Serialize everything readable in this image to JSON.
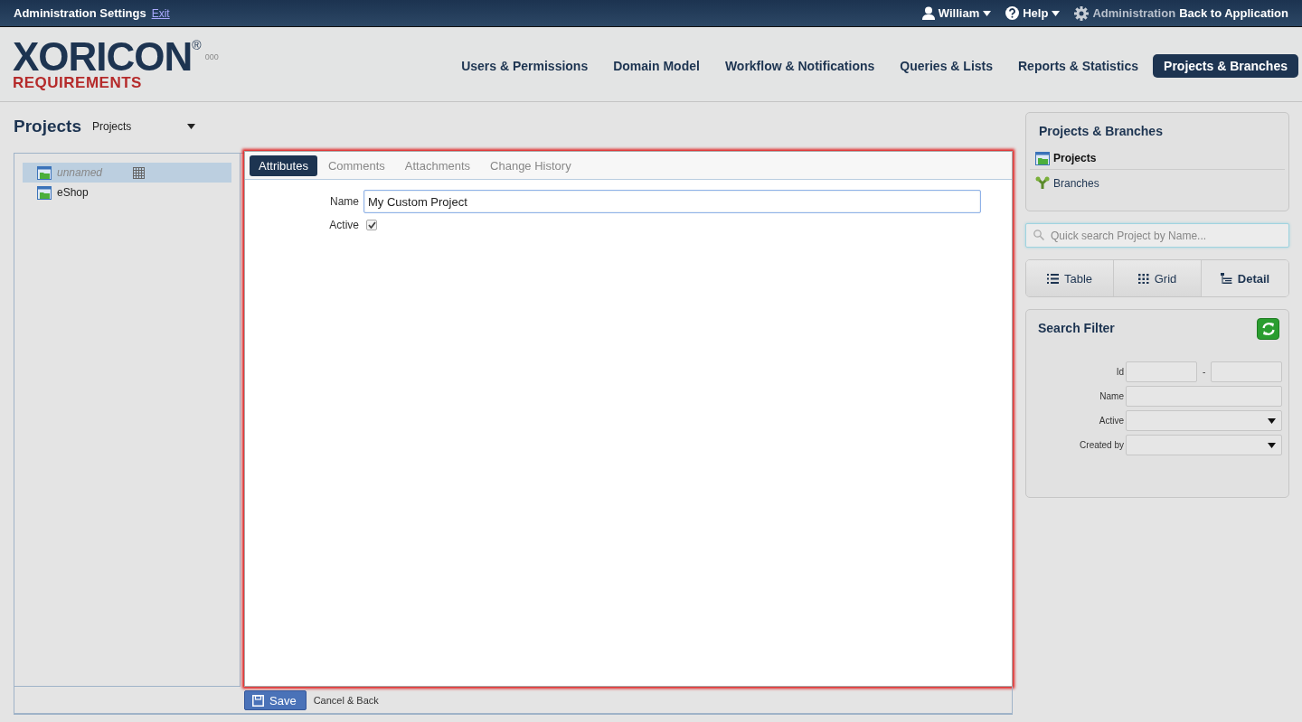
{
  "topbar": {
    "title": "Administration Settings",
    "exit_link": "Exit",
    "user": "William",
    "help": "Help",
    "admin": "Administration",
    "back": "Back to Application"
  },
  "logo": {
    "name": "XORICON",
    "mark": "®",
    "subtitle": "REQUIREMENTS",
    "version": "000"
  },
  "nav": [
    {
      "label": "Users & Permissions",
      "selected": false
    },
    {
      "label": "Domain Model",
      "selected": false
    },
    {
      "label": "Workflow & Notifications",
      "selected": false
    },
    {
      "label": "Queries & Lists",
      "selected": false
    },
    {
      "label": "Reports & Statistics",
      "selected": false
    },
    {
      "label": "Projects & Branches",
      "selected": true
    }
  ],
  "page": {
    "title": "Projects",
    "selector": "Projects"
  },
  "tree": [
    {
      "label": "unnamed",
      "kind": "unsaved",
      "selected": true
    },
    {
      "label": "eShop",
      "kind": "saved",
      "selected": false
    }
  ],
  "editor": {
    "tabs": [
      {
        "label": "Attributes",
        "selected": true
      },
      {
        "label": "Comments",
        "selected": false
      },
      {
        "label": "Attachments",
        "selected": false
      },
      {
        "label": "Change History",
        "selected": false
      }
    ],
    "fields": [
      {
        "label": "Name",
        "kind": "text",
        "value": "My Custom Project"
      },
      {
        "label": "Active",
        "kind": "checkbox",
        "checked": true
      }
    ]
  },
  "footer": {
    "save": "Save",
    "cancel": "Cancel & Back"
  },
  "side": {
    "title": "Projects & Branches",
    "items": [
      {
        "label": "Projects",
        "kind": "projects",
        "selected": true
      },
      {
        "label": "Branches",
        "kind": "branches",
        "selected": false
      }
    ]
  },
  "search": {
    "placeholder": "Quick search Project by Name..."
  },
  "views": [
    {
      "label": "Table",
      "kind": "table",
      "selected": false
    },
    {
      "label": "Grid",
      "kind": "grid",
      "selected": false
    },
    {
      "label": "Detail",
      "kind": "detail",
      "selected": true
    }
  ],
  "filter": {
    "title": "Search Filter",
    "rows": [
      {
        "label": "Id",
        "kind": "range",
        "separator": "-"
      },
      {
        "label": "Name",
        "kind": "text"
      },
      {
        "label": "Active",
        "kind": "select"
      },
      {
        "label": "Created by",
        "kind": "select"
      }
    ]
  }
}
